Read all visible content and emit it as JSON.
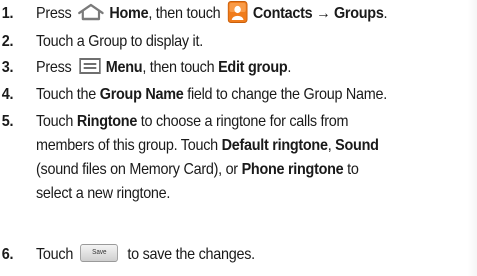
{
  "steps": [
    {
      "number": "1.",
      "press": "Press",
      "home_label": "Home",
      "then_touch": ", then touch",
      "contacts_label": "Contacts",
      "arrow_groups": "→ Groups",
      "end": "."
    },
    {
      "number": "2.",
      "text": "Touch a Group to display it."
    },
    {
      "number": "3.",
      "press": "Press",
      "menu_label": "Menu",
      "then_touch": ", then touch",
      "edit_group": "Edit group",
      "end": "."
    },
    {
      "number": "4.",
      "touch_the": "Touch the",
      "group_name_field": "Group Name",
      "rest": "field to change the Group Name."
    },
    {
      "number": "5.",
      "touch": "Touch",
      "ringtone": "Ringtone",
      "line1_rest": "to choose a ringtone for calls from",
      "line2_pre": "members of this group. Touch",
      "default_ringtone": "Default ringtone",
      "comma": ",",
      "sound": "Sound",
      "line3_pre": "(sound files on Memory Card), or",
      "phone_ringtone": "Phone ringtone",
      "line3_post": "to",
      "line4": "select a new ringtone."
    },
    {
      "number": "6.",
      "touch": "Touch",
      "save_button_label": "Save",
      "rest": "to save the changes."
    }
  ],
  "colors": {
    "text": "#1a1a1a",
    "contacts_icon": "#f07c1c"
  }
}
